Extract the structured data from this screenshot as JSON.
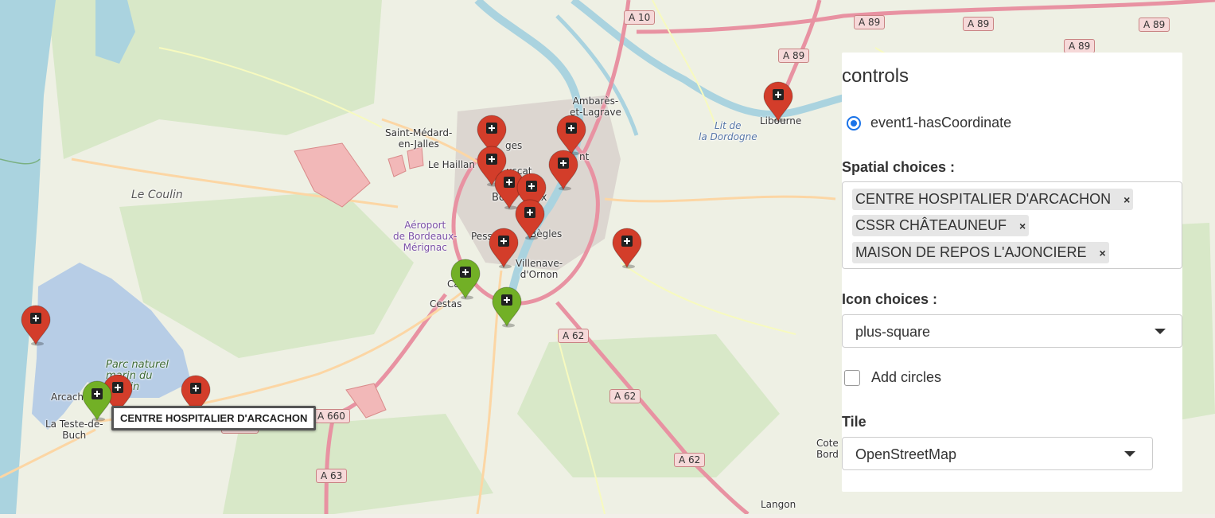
{
  "map": {
    "labels": {
      "saint_medard": "Saint-Médard-\nen-Jalles",
      "le_haillan": "Le Haillan",
      "le_coulin": "Le Coulin",
      "airport": "Aéroport\nde Bordeaux-\nMérignac",
      "pessac": "Pess",
      "begles": "Bègles",
      "villenave": "Villenave-\nd'Ornon",
      "cestas_1": "Ca",
      "cestas_2": "Cestas",
      "ambares": "Ambarès-\net-Lagrave",
      "la_dordogne": "Lit de\nla Dordogne",
      "libourne": "Libourne",
      "park": "Parc naturel\nmarin du\nBassin",
      "arcachon": "Arcach",
      "la_teste": "La Teste-de-\nBuch",
      "langon": "Langon",
      "cote_bord": "Cote\nBord",
      "bordeaux": "Bo     eaux",
      "bruges": "ges",
      "bouscat": "uscat",
      "lormont": "nt"
    },
    "shields": {
      "a10": "A 10",
      "a89_1": "A 89",
      "a89_2": "A 89",
      "a89_3": "A 89",
      "a89_4": "A 89",
      "a89_5": "A 89",
      "a62_1": "A 62",
      "a62_2": "A 62",
      "a62_3": "A 62",
      "a660_1": "A 660",
      "a660_2": "A 660",
      "a63": "A 63"
    },
    "marker_icon": "plus-square-icon",
    "marker_colors": {
      "red": "#d33d2a",
      "green": "#72b026"
    },
    "tooltip": "CENTRE HOSPITALIER D'ARCACHON"
  },
  "panel": {
    "title": "controls",
    "radio_label": "event1-hasCoordinate",
    "spatial_label": "Spatial choices :",
    "spatial_chips": [
      "CENTRE HOSPITALIER D'ARCACHON",
      "CSSR CHÂTEAUNEUF",
      "MAISON DE REPOS L'AJONCIERE"
    ],
    "chip_remove": "×",
    "icon_label": "Icon choices :",
    "icon_value": "plus-square",
    "circles_label": "Add circles",
    "tile_label": "Tile",
    "tile_value": "OpenStreetMap"
  }
}
